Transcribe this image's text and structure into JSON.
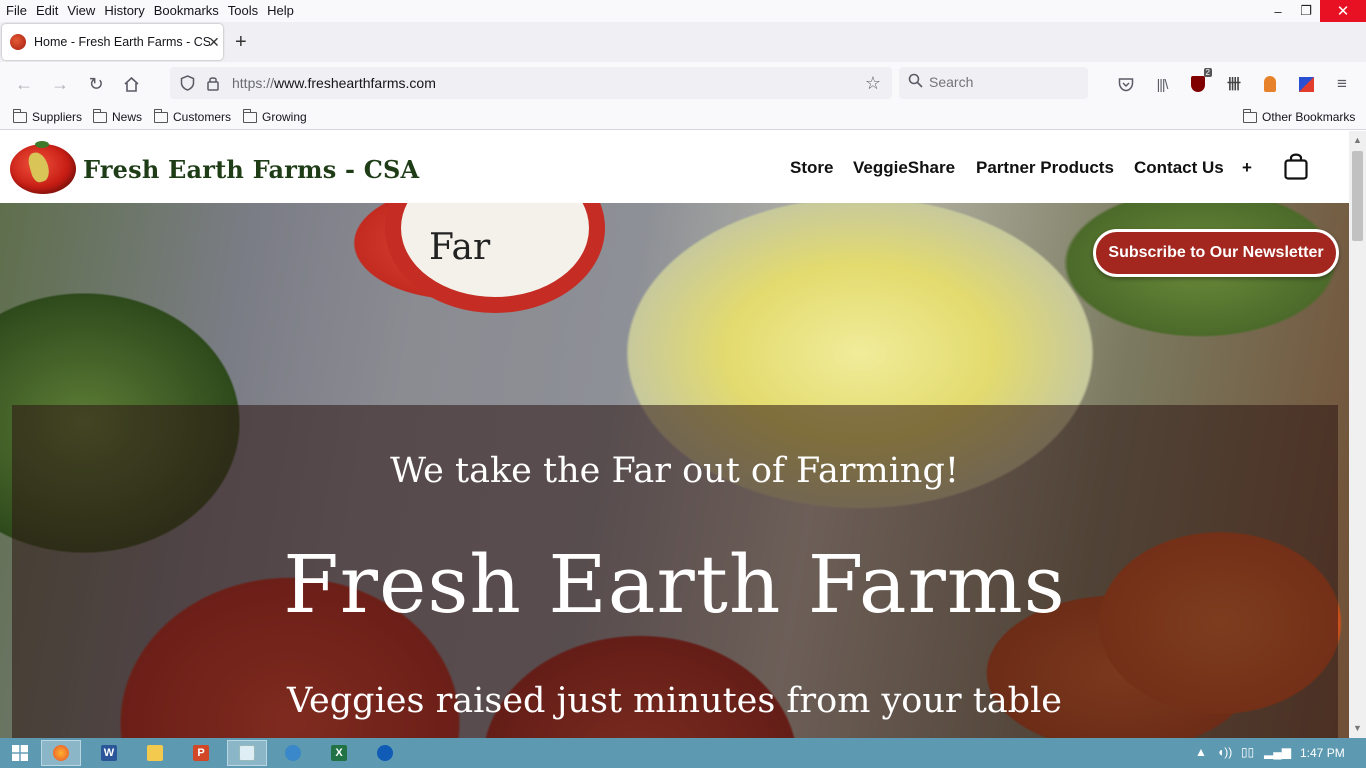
{
  "menubar": {
    "items": [
      "File",
      "Edit",
      "View",
      "History",
      "Bookmarks",
      "Tools",
      "Help"
    ]
  },
  "window_controls": {
    "minimize": "–",
    "restore": "❐",
    "close": "✕"
  },
  "tab": {
    "title": "Home - Fresh Earth Farms - CSA",
    "close": "✕"
  },
  "new_tab": "+",
  "navbar": {
    "url_host": "www.freshearthfarms.com",
    "url_scheme": "https://",
    "search_placeholder": "Search",
    "extension_badge": "2"
  },
  "bookmarks": {
    "items": [
      "Suppliers",
      "News",
      "Customers",
      "Growing"
    ],
    "other": "Other Bookmarks"
  },
  "site": {
    "title": "Fresh Earth Farms - CSA",
    "nav": [
      "Store",
      "VeggieShare",
      "Partner Products",
      "Contact Us",
      "+"
    ],
    "subscribe_button": "Subscribe to Our Newsletter",
    "hero_sign_text": "Far",
    "hero_tagline": "We take the Far out of Farming!",
    "hero_title": "Fresh Earth Farms",
    "hero_subtitle": "Veggies raised just minutes from your table"
  },
  "taskbar": {
    "apps": [
      "start",
      "firefox",
      "word",
      "file-explorer",
      "powerpoint",
      "notepad",
      "network-app",
      "excel",
      "outlook"
    ],
    "clock": "1:47 PM"
  },
  "colors": {
    "brand_red": "#a3261f",
    "title_green": "#1e3c16",
    "taskbar": "#5d9ab2",
    "close_button": "#e81123"
  }
}
